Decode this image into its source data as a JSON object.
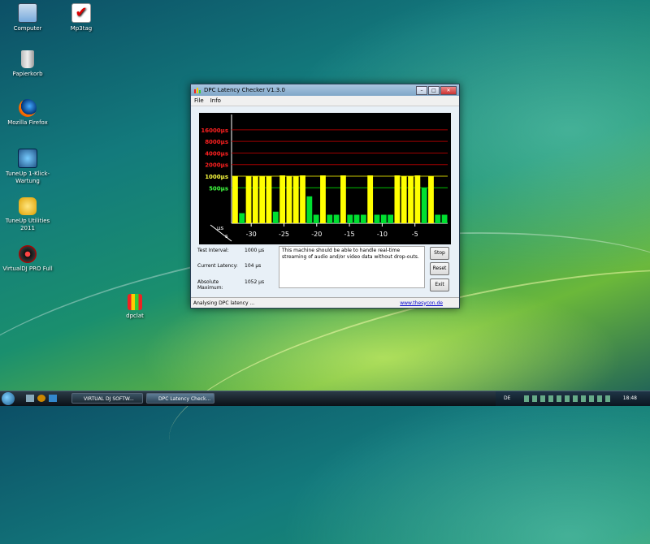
{
  "desktop": {
    "icons": [
      {
        "label": "Computer"
      },
      {
        "label": "Mp3tag"
      },
      {
        "label": "Papierkorb"
      },
      {
        "label": "Mozilla Firefox"
      },
      {
        "label": "TuneUp 1-Klick-Wartung"
      },
      {
        "label": "TuneUp Utilities 2011"
      },
      {
        "label": "VirtualDJ PRO Full"
      },
      {
        "label": "dpclat"
      }
    ]
  },
  "window": {
    "title": "DPC Latency Checker V1.3.0",
    "menu": [
      "File",
      "Info"
    ],
    "info": {
      "test_interval_label": "Test Interval:",
      "test_interval_value": "1000 µs",
      "current_latency_label": "Current Latency:",
      "current_latency_value": "104 µs",
      "absolute_max_label": "Absolute Maximum:",
      "absolute_max_value": "1052 µs",
      "message": "This machine should be able to handle real-time streaming of audio and/or video data without drop-outs."
    },
    "buttons": {
      "stop": "Stop",
      "reset": "Reset",
      "exit": "Exit"
    },
    "status": {
      "text": "Analysing DPC latency ...",
      "link": "www.thesycon.de"
    }
  },
  "chart_data": {
    "type": "bar",
    "y_tick_labels": [
      "16000µs",
      "8000µs",
      "4000µs",
      "2000µs",
      "1000µs",
      "500µs"
    ],
    "y_tick_colors": [
      "#ff2020",
      "#ff2020",
      "#ff2020",
      "#ff2020",
      "#ffff40",
      "#40ff40"
    ],
    "ylabel": "µs",
    "xlabel": "s",
    "x_tick_labels": [
      "-30",
      "-25",
      "-20",
      "-15",
      "-10",
      "-5"
    ],
    "x_range": [
      -33,
      0
    ],
    "values": [
      1000,
      110,
      1000,
      1000,
      1000,
      1000,
      120,
      1050,
      1000,
      1000,
      1050,
      300,
      100,
      1050,
      100,
      100,
      1050,
      100,
      100,
      100,
      1050,
      100,
      100,
      100,
      1050,
      1000,
      1000,
      1050,
      500,
      1000,
      100,
      100
    ],
    "colors": {
      "high": "#ffff00",
      "low": "#00e030",
      "grid_red": "#a00000",
      "grid_yellow": "#c8c800",
      "grid_green": "#00c000"
    }
  },
  "taskbar": {
    "items": [
      "VIRTUAL DJ SOFTW...",
      "DPC Latency Check..."
    ],
    "lang": "DE",
    "clock": "18:48"
  }
}
